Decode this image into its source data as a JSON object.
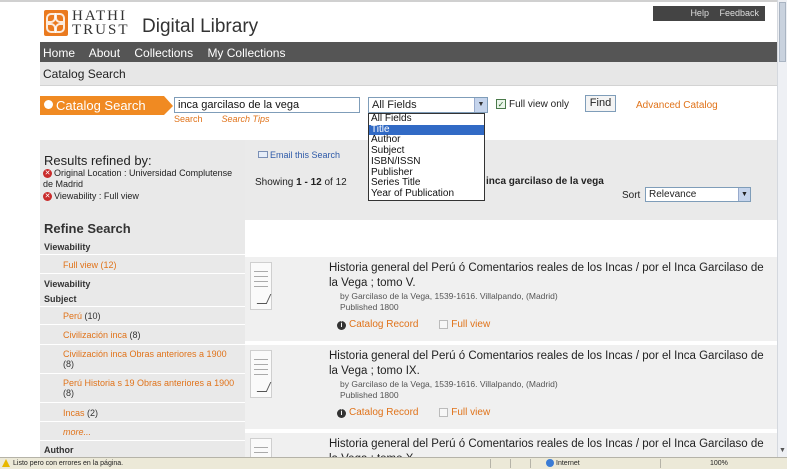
{
  "header": {
    "logo_line1": "HATHI",
    "logo_line2": "TRUST",
    "title": "Digital Library",
    "links": [
      "Help",
      "Feedback"
    ]
  },
  "nav": {
    "items": [
      "Home",
      "About",
      "Collections",
      "My Collections"
    ]
  },
  "breadcrumb": "Catalog Search",
  "search": {
    "label": "Catalog Search",
    "query": "inca garcilaso de la vega",
    "search_link": "Search",
    "tips_link": "Search Tips",
    "field_selected": "All Fields",
    "field_options": [
      "All Fields",
      "Title",
      "Author",
      "Subject",
      "ISBN/ISSN",
      "Publisher",
      "Series Title",
      "Year of Publication"
    ],
    "highlighted_option": "Title",
    "full_view_only_label": "Full view only",
    "full_view_only_checked": true,
    "find_button": "Find",
    "advanced_link": "Advanced Catalog"
  },
  "sidebar": {
    "results_refined_title": "Results refined by:",
    "filters": [
      "Original Location : Universidad Complutense de Madrid",
      "Viewability : Full view"
    ],
    "refine_title": "Refine Search",
    "facets": [
      {
        "name": "Viewability",
        "items": [
          {
            "label": "Full view",
            "count": "(12)"
          }
        ]
      },
      {
        "name": "Viewability",
        "items": []
      },
      {
        "name": "Subject",
        "items": [
          {
            "label": "Perú",
            "count": "(10)"
          },
          {
            "label": "Civilización inca",
            "count": "(8)"
          },
          {
            "label": "Civilización inca Obras anteriores a 1900",
            "count": "(8)"
          },
          {
            "label": "Perú Historia s 19 Obras anteriores a 1900",
            "count": "(8)"
          },
          {
            "label": "Incas",
            "count": "(2)"
          }
        ]
      },
      {
        "name": "Author",
        "items": []
      }
    ],
    "more_link": "more..."
  },
  "main": {
    "email_link": "Email this Search",
    "showing_prefix": "Showing",
    "showing_range": "1 - 12",
    "showing_suffix": "of 12",
    "query_echo": "inca garcilaso de la vega",
    "sort_label": "Sort",
    "sort_value": "Relevance",
    "results": [
      {
        "title": "Historia general del Perú ó Comentarios reales de los Incas / por el Inca Garcilaso de la Vega ; tomo V.",
        "byline": "by Garcilaso de la Vega, 1539-1616. Villalpando, (Madrid)",
        "published": "Published 1800",
        "catalog_record": "Catalog Record",
        "full_view": "Full view"
      },
      {
        "title": "Historia general del Perú ó Comentarios reales de los Incas / por el Inca Garcilaso de la Vega ; tomo IX.",
        "byline": "by Garcilaso de la Vega, 1539-1616. Villalpando, (Madrid)",
        "published": "Published 1800",
        "catalog_record": "Catalog Record",
        "full_view": "Full view"
      },
      {
        "title": "Historia general del Perú ó Comentarios reales de los Incas / por el Inca Garcilaso de la Vega ; tomo X.",
        "byline": "",
        "published": "",
        "catalog_record": "",
        "full_view": ""
      }
    ]
  },
  "statusbar": {
    "message": "Listo pero con errores en la página.",
    "zone": "Internet",
    "zoom": "100%"
  },
  "colors": {
    "accent_orange": "#f08a22",
    "nav_gray": "#555555",
    "link_orange": "#e0731a",
    "selection_blue": "#316ac5"
  }
}
